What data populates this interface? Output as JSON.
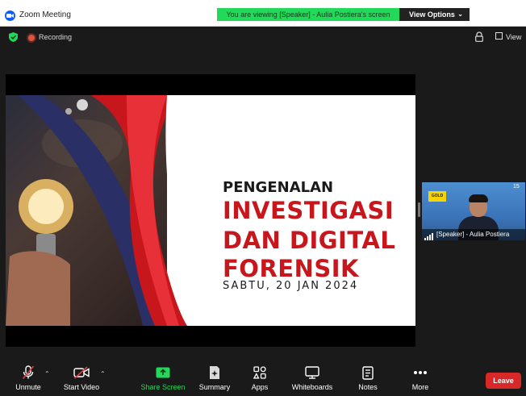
{
  "window": {
    "title": "Zoom Meeting"
  },
  "share_banner": {
    "text": "You are viewing [Speaker] - Aulia Postiera's screen",
    "view_options_label": "View Options"
  },
  "meeting_bar": {
    "recording_label": "Recording",
    "view_label": "View"
  },
  "slide": {
    "line1": "PENGENALAN",
    "line2": "INVESTIGASI",
    "line3": "DAN DIGITAL",
    "line4": "FORENSIK",
    "date": "SABTU, 20 JAN 2024"
  },
  "participant": {
    "name": "[Speaker] - Aulia Postiera",
    "badge": "GOLD",
    "count": "15"
  },
  "toolbar": {
    "unmute": "Unmute",
    "start_video": "Start Video",
    "share_screen": "Share Screen",
    "summary": "Summary",
    "apps": "Apps",
    "whiteboards": "Whiteboards",
    "notes": "Notes",
    "more": "More",
    "leave": "Leave"
  },
  "colors": {
    "accent_green": "#23d959",
    "brand_blue": "#0b5cff",
    "leave_red": "#d92828",
    "slide_red": "#c8161d"
  }
}
